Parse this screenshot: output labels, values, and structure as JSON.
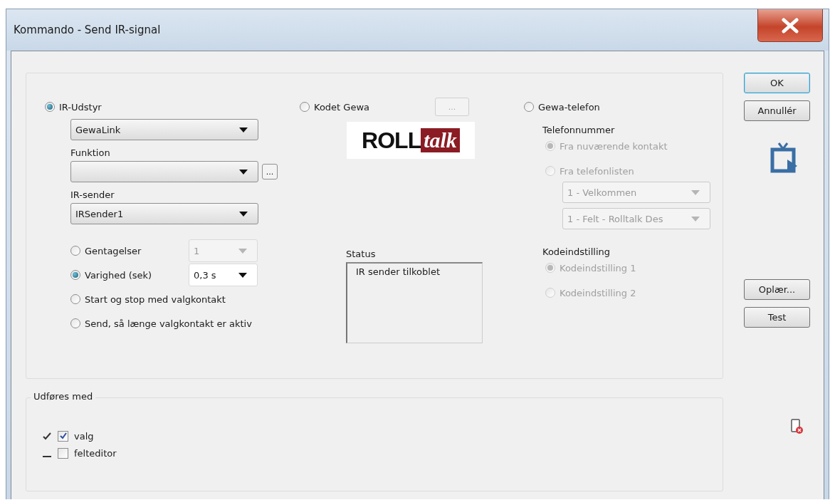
{
  "window": {
    "title": "Kommando - Send IR-signal"
  },
  "ir": {
    "label": "IR-Udstyr",
    "selected": true,
    "device": "GewaLink",
    "function_label": "Funktion",
    "function_browse": "...",
    "sender_label": "IR-sender",
    "sender": "IRSender1",
    "modes": [
      {
        "label": "Gentagelser",
        "selected": false,
        "value": "1",
        "disabled": true
      },
      {
        "label": "Varighed (sek)",
        "selected": true,
        "value": "0,3 s",
        "disabled": false
      },
      {
        "label": "Start og stop med valgkontakt",
        "selected": false
      },
      {
        "label": "Send, så længe valgkontakt er aktiv",
        "selected": false
      }
    ]
  },
  "coded": {
    "label": "Kodet Gewa",
    "selected": false,
    "browse": "...",
    "browse_disabled": true,
    "logo_bold": "ROLL",
    "logo_italic": "talk"
  },
  "status": {
    "label": "Status",
    "text": "IR sender tilkoblet"
  },
  "phone": {
    "label": "Gewa-telefon",
    "selected": false,
    "number_label": "Telefonnummer",
    "sources": [
      {
        "label": "Fra nuværende kontakt",
        "selected": true,
        "disabled": true
      },
      {
        "label": "Fra telefonlisten",
        "selected": false,
        "disabled": true
      }
    ],
    "lists": [
      "1 - Velkommen",
      "1 - Felt - Rolltalk Des"
    ],
    "code_label": "Kodeindstilling",
    "codes": [
      {
        "label": "Kodeindstilling 1",
        "selected": true,
        "disabled": true
      },
      {
        "label": "Kodeindstilling 2",
        "selected": false,
        "disabled": true
      }
    ]
  },
  "buttons": [
    {
      "label": "OK",
      "default": true
    },
    {
      "label": "Annullér",
      "default": false
    }
  ],
  "actions": [
    {
      "label": "Oplær..."
    },
    {
      "label": "Test"
    }
  ],
  "performed": {
    "label": "Udføres med",
    "items": [
      {
        "label": "valg",
        "checked": true
      },
      {
        "label": "felteditor",
        "checked": false
      }
    ]
  }
}
